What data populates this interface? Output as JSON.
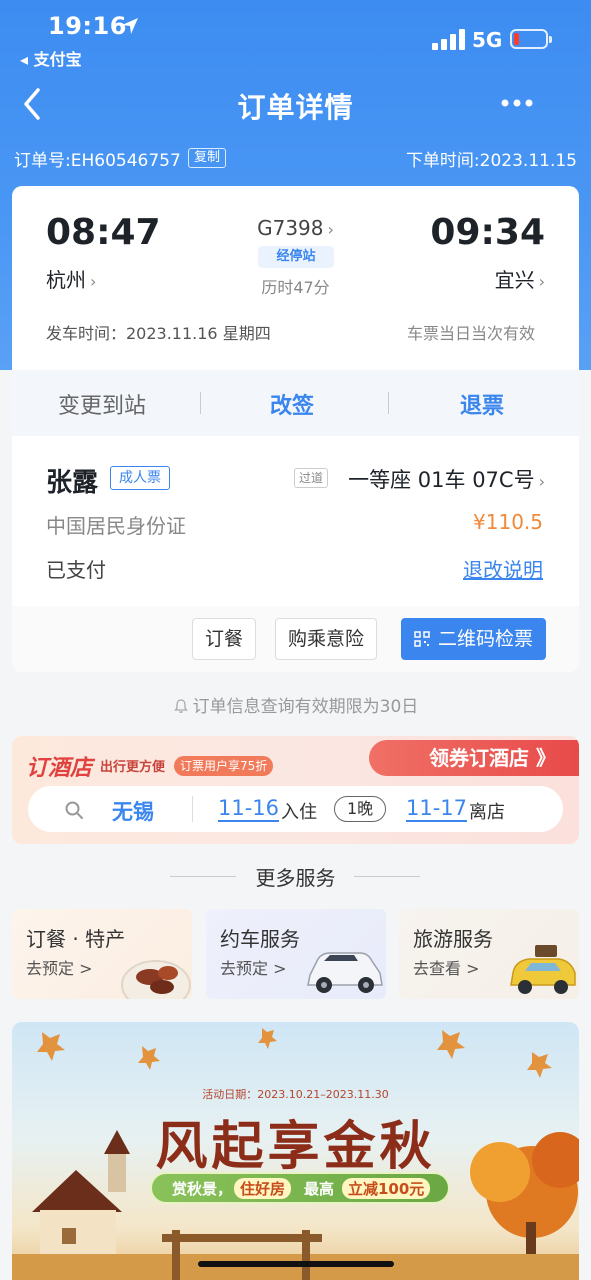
{
  "status_bar": {
    "time": "19:16",
    "back_app": "◂ 支付宝",
    "network": "5G"
  },
  "nav": {
    "title": "订单详情"
  },
  "order": {
    "number_label": "订单号:EH60546757",
    "copy_label": "复制",
    "order_time": "下单时间:2023.11.15"
  },
  "trip": {
    "dep_time": "08:47",
    "dep_city": "杭州",
    "arr_time": "09:34",
    "arr_city": "宜兴",
    "train_no": "G7398",
    "stops_label": "经停站",
    "duration": "历时47分",
    "dep_date": "发车时间：2023.11.16 星期四",
    "valid_note": "车票当日当次有效"
  },
  "actions": {
    "change_station": "变更到站",
    "resign": "改签",
    "refund": "退票"
  },
  "passenger": {
    "name": "张露",
    "ticket_type": "成人票",
    "seat_tag": "过道",
    "seat": "一等座 01车 07C号",
    "id_type": "中国居民身份证",
    "price": "¥110.5",
    "pay_status": "已支付",
    "refund_rules": "退改说明"
  },
  "passenger_buttons": {
    "meal": "订餐",
    "insurance": "购乘意险",
    "qr": "二维码检票"
  },
  "validity_note": "订单信息查询有效期限为30日",
  "hotel": {
    "title": "订酒店",
    "subtitle": "出行更方便",
    "promo": "订票用户享75折",
    "coupon": "领券订酒店 》",
    "city": "无锡",
    "checkin_date": "11-16",
    "checkin_label": "入住",
    "nights": "1晚",
    "checkout_date": "11-17",
    "checkout_label": "离店"
  },
  "more_services": {
    "title": "更多服务",
    "items": [
      {
        "title": "订餐 · 特产",
        "sub": "去预定 >"
      },
      {
        "title": "约车服务",
        "sub": "去预定 >"
      },
      {
        "title": "旅游服务",
        "sub": "去查看 >"
      }
    ]
  },
  "banner": {
    "date": "活动日期：2023.10.21–2023.11.30",
    "title": "风起享金秋",
    "pill_a": "赏秋景，",
    "pill_b": "住好房",
    "pill_c": "最高",
    "pill_d": "立减100元"
  },
  "colors": {
    "header_blue": "#3d8cf1",
    "accent_blue": "#3b86ee",
    "price_orange": "#f08a3a",
    "hotel_red": "#e0423f"
  }
}
